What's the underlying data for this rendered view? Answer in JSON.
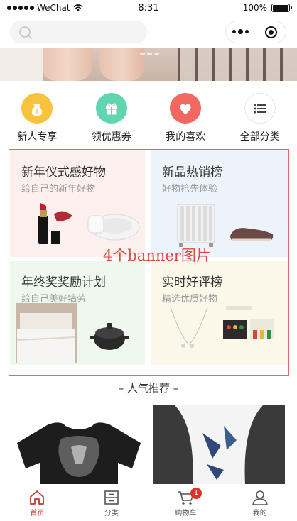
{
  "status_bar": {
    "carrier": "WeChat",
    "time": "8:31",
    "battery": "100%",
    "battery_level": 1.0
  },
  "search": {
    "icon": "search-icon"
  },
  "capsule": {
    "more_icon": "more-dots-icon",
    "close_icon": "target-icon"
  },
  "categories": [
    {
      "label": "新人专享",
      "icon": "coin-bag-icon",
      "color": "#f7c23c"
    },
    {
      "label": "领优惠券",
      "icon": "gift-icon",
      "color": "#5fd6b0"
    },
    {
      "label": "我的喜欢",
      "icon": "heart-icon",
      "color": "#f0685f"
    },
    {
      "label": "全部分类",
      "icon": "list-icon",
      "color": "#ffffff"
    }
  ],
  "banners": [
    {
      "title": "新年仪式感好物",
      "subtitle": "给自己的新年好物",
      "bg": "#fbf0ee"
    },
    {
      "title": "新品热销榜",
      "subtitle": "好物抢先体验",
      "bg": "#edf3fb"
    },
    {
      "title": "年终奖奖励计划",
      "subtitle": "给自己美好犒劳",
      "bg": "#eef8ef"
    },
    {
      "title": "实时好评榜",
      "subtitle": "精选优质好物",
      "bg": "#fbf8ea"
    }
  ],
  "annotation": "4个banner图片",
  "section": {
    "title": "– 人气推荐 –"
  },
  "tabs": [
    {
      "label": "首页",
      "icon": "home-icon",
      "active": true
    },
    {
      "label": "分类",
      "icon": "category-icon",
      "active": false
    },
    {
      "label": "购物车",
      "icon": "cart-icon",
      "active": false,
      "badge": "1"
    },
    {
      "label": "我的",
      "icon": "user-icon",
      "active": false
    }
  ],
  "colors": {
    "accent": "#c1362f",
    "badge": "#e0302a",
    "annotation": "#e0483f"
  }
}
